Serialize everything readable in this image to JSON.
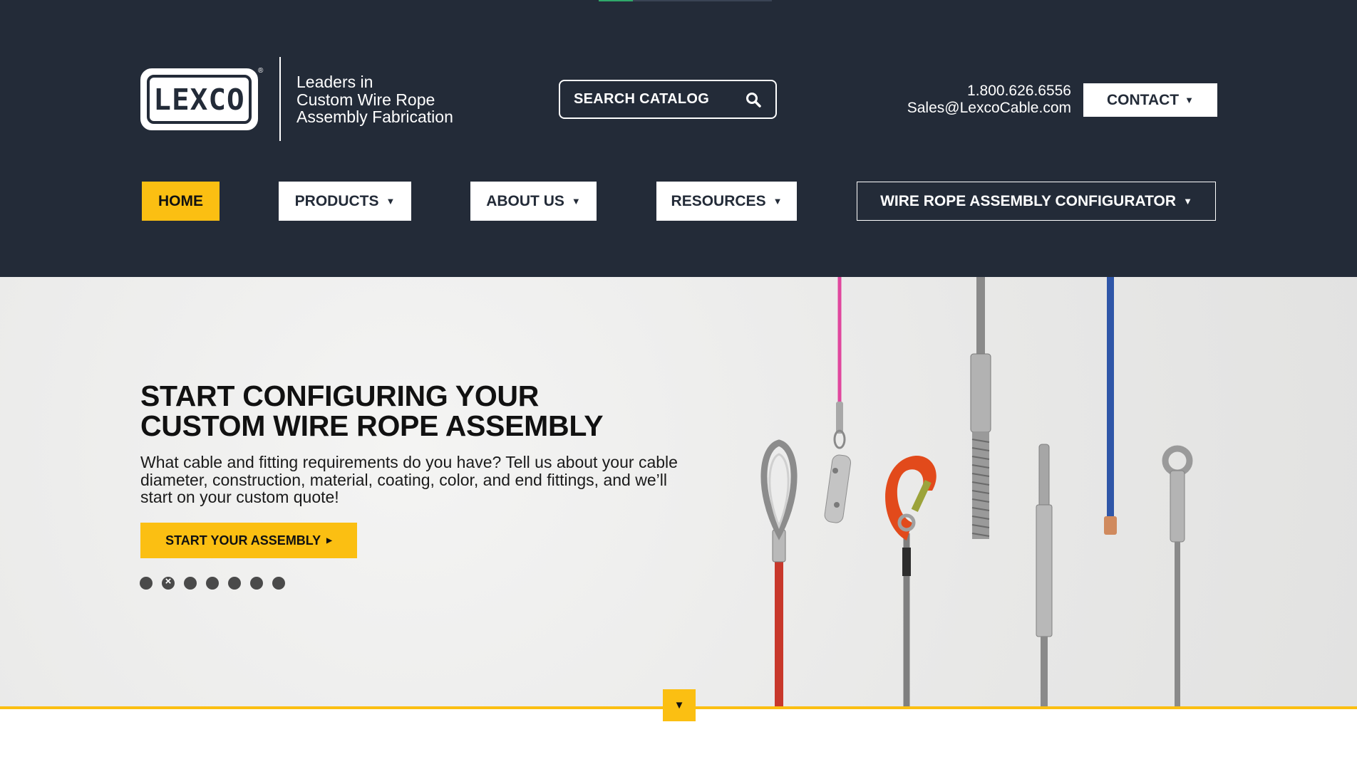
{
  "header": {
    "logo_text": "LEXCO",
    "tagline_lines": [
      "Leaders in",
      "Custom Wire Rope",
      "Assembly Fabrication"
    ],
    "search_label": "SEARCH CATALOG",
    "phone": "1.800.626.6556",
    "email": "Sales@LexcoCable.com",
    "contact_label": "CONTACT",
    "caret": "▼"
  },
  "nav": {
    "home": "HOME",
    "products": "PRODUCTS",
    "about": "ABOUT US",
    "resources": "RESOURCES",
    "configurator": "WIRE ROPE ASSEMBLY CONFIGURATOR",
    "caret": "▼"
  },
  "hero": {
    "title_line1": "START CONFIGURING YOUR",
    "title_line2": "CUSTOM WIRE ROPE ASSEMBLY",
    "body": "What cable and fitting requirements do you have? Tell us about your cable diameter, construction, material, coating, color, and end fittings, and we’ll start on your custom quote!",
    "cta_label": "START YOUR ASSEMBLY",
    "cta_caret": "▶",
    "slide_count": 7,
    "active_slide": 2
  },
  "scroll_down": "▼",
  "colors": {
    "header_bg": "#232b38",
    "accent_yellow": "#fbbf12",
    "hero_bg": "#ececeb"
  }
}
